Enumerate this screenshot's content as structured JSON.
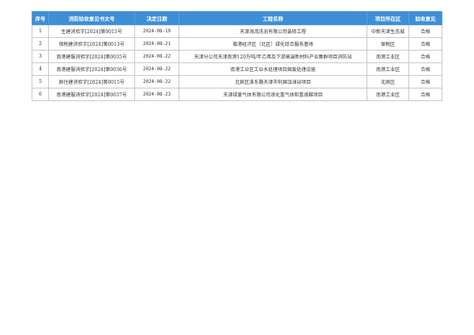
{
  "table": {
    "headers": [
      "序号",
      "消防验收意见书文号",
      "决定日期",
      "工程名称",
      "项目所在区",
      "验收意见"
    ],
    "rows": [
      [
        "1",
        "生建消验字[2024]第0015号",
        "2024-08-19",
        "天津海湾洗浴有限公司装修工程",
        "中新天津生态城",
        "合格"
      ],
      [
        "2",
        "保税建消验字[2024]第0013号",
        "2024-08-21",
        "临港经济区（北区）绿化综合服务基地",
        "保税区",
        "合格"
      ],
      [
        "3",
        "南港建服消验字[2024]第0035号",
        "2024-08-22",
        "天津分公司天津南港120万吨/年乙烯及下游高端新材料产业集群项目消防站",
        "南港工业区",
        "合格"
      ],
      [
        "4",
        "南港建服消验字[2024]第0036号",
        "2024-08-22",
        "南港工业区工业水处理项目固废处理设施",
        "南港工业区",
        "合格"
      ],
      [
        "5",
        "辰住建消验字[2024]第0015号",
        "2024-08-22",
        "北辰区淮东路天津市利国加油站项目",
        "北辰区",
        "合格"
      ],
      [
        "6",
        "南港建服消验字[2024]第0037号",
        "2024-08-23",
        "天津绿菱气体有限公司液化氢气体和氢液酸项目",
        "南港工业区",
        "合格"
      ]
    ]
  }
}
